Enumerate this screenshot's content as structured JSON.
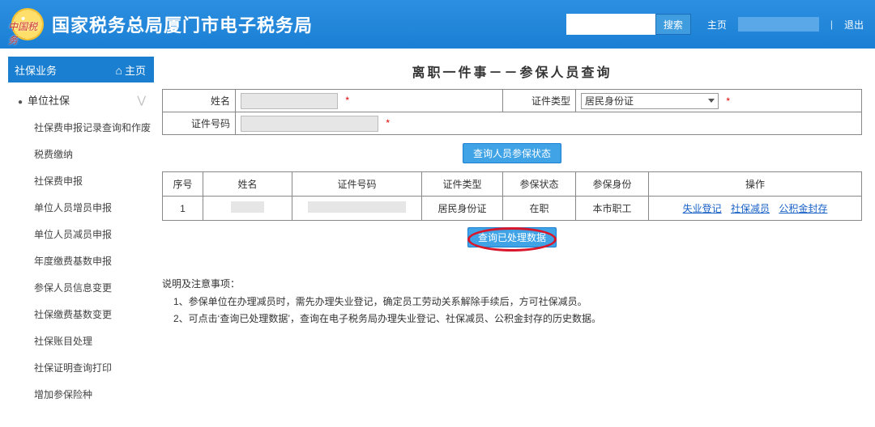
{
  "header": {
    "site_title": "国家税务总局厦门市电子税务局",
    "search_btn": "搜索",
    "home": "主页",
    "exit": "退出"
  },
  "sidebar": {
    "module": "社保业务",
    "back_home": "主页",
    "parent": "单位社保",
    "items": [
      "社保费申报记录查询和作废",
      "税费缴纳",
      "社保费申报",
      "单位人员增员申报",
      "单位人员减员申报",
      "年度缴费基数申报",
      "参保人员信息变更",
      "社保缴费基数变更",
      "社保账目处理",
      "社保证明查询打印",
      "增加参保险种"
    ]
  },
  "page": {
    "title": "离职一件事－－参保人员查询",
    "fields": {
      "name_label": "姓名",
      "id_type_label": "证件类型",
      "id_type_value": "居民身份证",
      "id_no_label": "证件号码"
    },
    "query_status_btn": "查询人员参保状态",
    "processed_btn": "查询已处理数据"
  },
  "table": {
    "headers": [
      "序号",
      "姓名",
      "证件号码",
      "证件类型",
      "参保状态",
      "参保身份",
      "操作"
    ],
    "row": {
      "seq": "1",
      "id_type": "居民身份证",
      "status": "在职",
      "role": "本市职工",
      "ops": [
        "失业登记",
        "社保减员",
        "公积金封存"
      ]
    }
  },
  "notes": {
    "title": "说明及注意事项：",
    "items": [
      "1、参保单位在办理减员时，需先办理失业登记，确定员工劳动关系解除手续后，方可社保减员。",
      "2、可点击‘查询已处理数据’，查询在电子税务局办理失业登记、社保减员、公积金封存的历史数据。"
    ]
  }
}
